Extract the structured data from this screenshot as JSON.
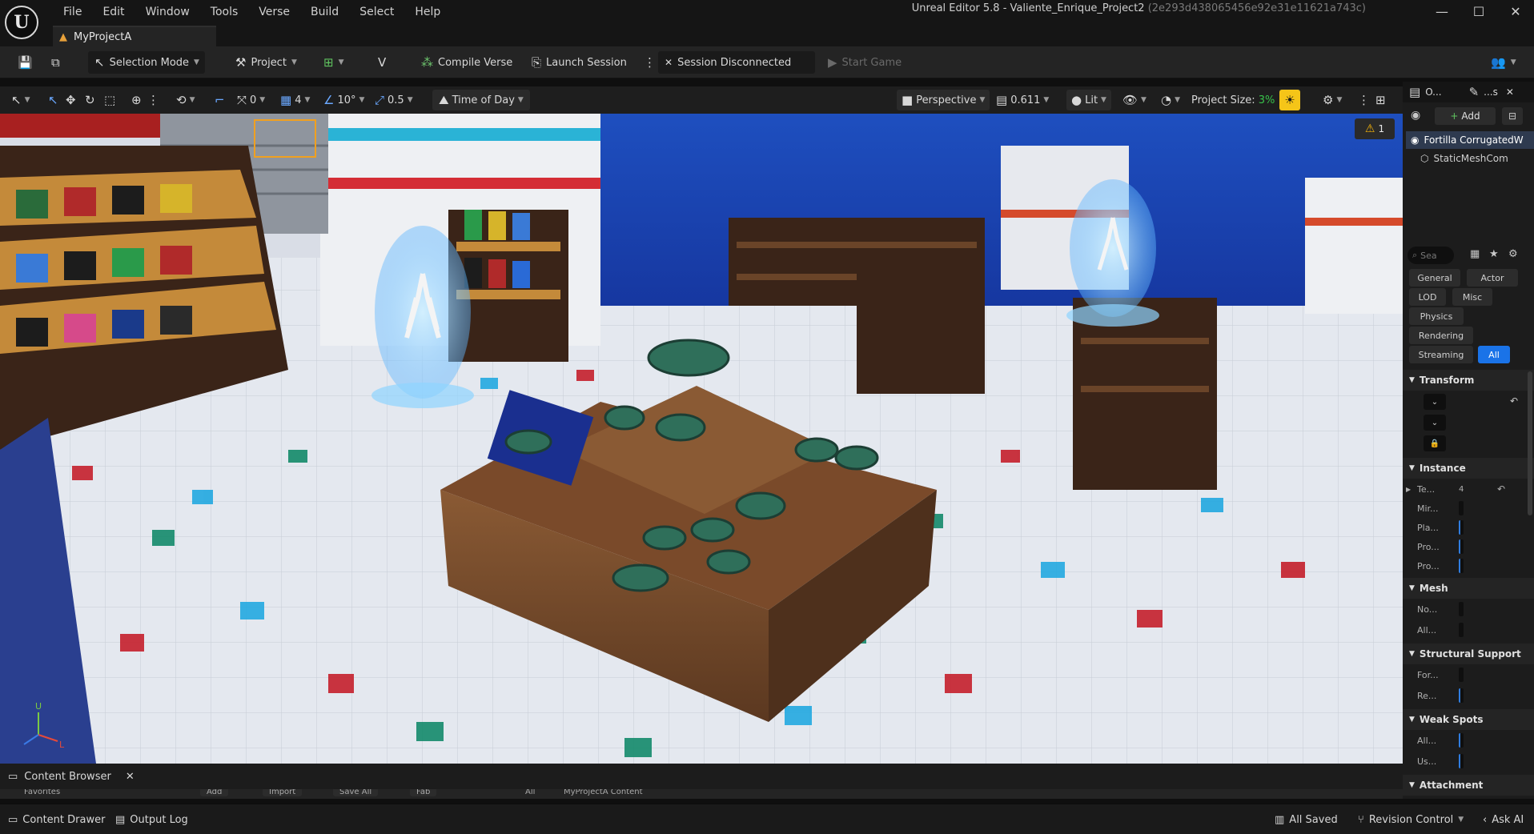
{
  "window": {
    "title": "Unreal Editor 5.8 - Valiente_Enrique_Project2",
    "hash": "(2e293d438065456e92e31e11621a743c)",
    "logo": "U",
    "controls": [
      "minimize-icon",
      "maximize-icon",
      "close-icon"
    ]
  },
  "menu": {
    "items": [
      "File",
      "Edit",
      "Window",
      "Tools",
      "Verse",
      "Build",
      "Select",
      "Help"
    ]
  },
  "project_tab": {
    "label": "MyProjectA",
    "icon": "level-icon"
  },
  "toolbar": {
    "selection_mode": "Selection Mode",
    "project": "Project",
    "compile_verse": "Compile Verse",
    "launch_session": "Launch Session",
    "session_status": "Session Disconnected",
    "start_game": "Start Game"
  },
  "viewport_toolbar": {
    "snap_rotation_value": "0",
    "grid_value": "4",
    "angle_value": "10°",
    "scale_value": "0.5",
    "time_of_day": "Time of Day",
    "perspective": "Perspective",
    "speed": "0.611",
    "lit": "Lit",
    "project_size_label": "Project Size:",
    "project_size_value": "3%"
  },
  "viewport": {
    "warning_count": "1",
    "axis_u": "U",
    "axis_l": "L"
  },
  "outliner": {
    "tab_label": "O...",
    "tab2_label": "...s",
    "add_label": "Add",
    "items": [
      {
        "label": "Fortilla CorrugatedW"
      },
      {
        "label": "StaticMeshCom"
      }
    ]
  },
  "details": {
    "search_placeholder": "Sea",
    "filters": [
      "General",
      "Actor",
      "LOD",
      "Misc",
      "Physics",
      "Rendering",
      "Streaming",
      "All"
    ],
    "sections": [
      {
        "title": "Transform",
        "rows": []
      },
      {
        "title": "Instance",
        "rows": [
          "Te...",
          "Mir...",
          "Pla...",
          "Pro...",
          "Pro..."
        ]
      },
      {
        "title": "Mesh",
        "rows": [
          "No...",
          "All..."
        ]
      },
      {
        "title": "Structural Support",
        "rows": [
          "For...",
          "Re..."
        ]
      },
      {
        "title": "Weak Spots",
        "rows": [
          "All...",
          "Us..."
        ]
      },
      {
        "title": "Attachment",
        "rows": []
      }
    ],
    "instance_value": "4"
  },
  "content_browser": {
    "tab_label": "Content Browser",
    "strip_items": [
      "Favorites",
      "Add",
      "Import",
      "Save All",
      "Fab",
      "All",
      "MyProjectA Content"
    ]
  },
  "status_bar": {
    "content_drawer": "Content Drawer",
    "output_log": "Output Log",
    "all_saved": "All Saved",
    "revision_control": "Revision Control",
    "ask_ai": "Ask AI"
  },
  "colors": {
    "accent_blue": "#1a73e8",
    "warning": "#f2b20a",
    "project_size_green": "#37c24a",
    "highlight_yellow": "#f5c518"
  }
}
